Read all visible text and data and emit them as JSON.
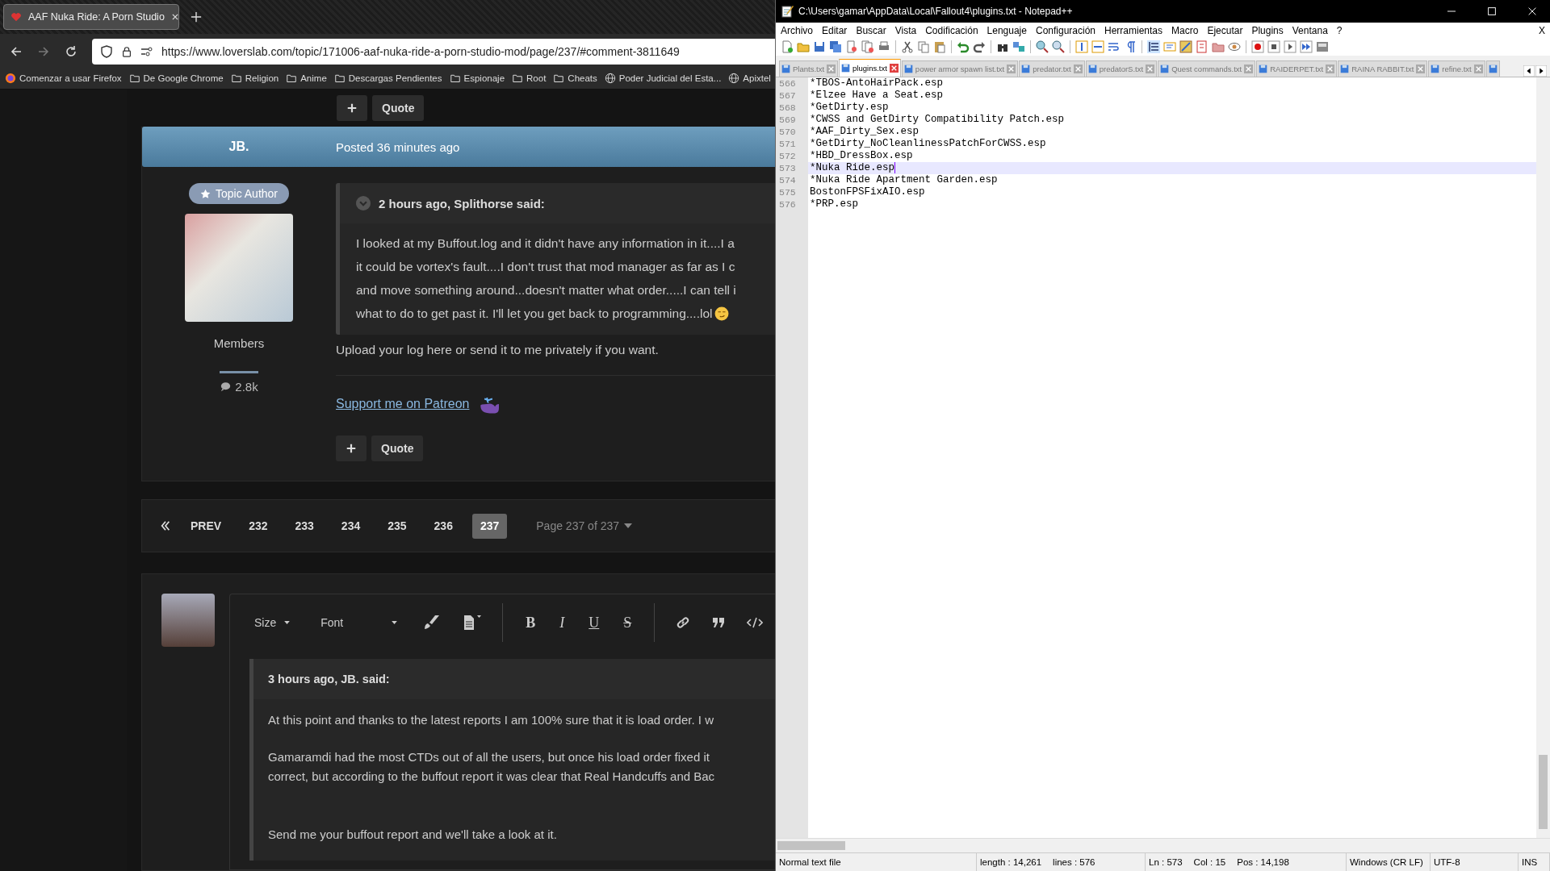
{
  "browser": {
    "tab": {
      "title": "AAF Nuka Ride: A Porn Studio"
    },
    "url": "https://www.loverslab.com/topic/171006-aaf-nuka-ride-a-porn-studio-mod/page/237/#comment-3811649",
    "bookmarks": [
      {
        "label": "Comenzar a usar Firefox",
        "kind": "firefox"
      },
      {
        "label": "De Google Chrome",
        "kind": "folder"
      },
      {
        "label": "Religion",
        "kind": "folder"
      },
      {
        "label": "Anime",
        "kind": "folder"
      },
      {
        "label": "Descargas Pendientes",
        "kind": "folder"
      },
      {
        "label": "Espionaje",
        "kind": "folder"
      },
      {
        "label": "Root",
        "kind": "folder"
      },
      {
        "label": "Cheats",
        "kind": "folder"
      },
      {
        "label": "Poder Judicial del Esta...",
        "kind": "globe"
      },
      {
        "label": "Apixtel",
        "kind": "globe"
      }
    ]
  },
  "forum": {
    "top_action": "Quote",
    "post": {
      "author": "JB.",
      "posted": "Posted 36 minutes ago",
      "badge": "Topic Author",
      "group": "Members",
      "post_count": "2.8k",
      "quote": {
        "header": "2 hours ago, Splithorse said:",
        "lines": [
          "I looked at my Buffout.log and it didn't have any information in it....I a",
          "it could be vortex's fault....I don't trust that mod manager as far as I c",
          "and move something around...doesn't matter what order.....I can tell i",
          "what to do to get past it.  I'll let you get back to programming....lol"
        ]
      },
      "text": "Upload your log here or send it to me privately if you want.",
      "link": "Support me on Patreon",
      "action": "Quote"
    },
    "pagination": {
      "prev": "PREV",
      "pages": [
        {
          "label": "232",
          "selected": false
        },
        {
          "label": "233",
          "selected": false
        },
        {
          "label": "234",
          "selected": false
        },
        {
          "label": "235",
          "selected": false
        },
        {
          "label": "236",
          "selected": false
        },
        {
          "label": "237",
          "selected": true
        }
      ],
      "jump": "Page 237 of 237"
    },
    "editor": {
      "size": "Size",
      "font": "Font",
      "format_buttons": [
        {
          "label": "B",
          "kind": "bold"
        },
        {
          "label": "I",
          "kind": "italic"
        },
        {
          "label": "U",
          "kind": "underline"
        },
        {
          "label": "S",
          "kind": "strike"
        }
      ],
      "quote": {
        "header": "3 hours ago, JB. said:",
        "paragraphs": [
          [
            "At this point and thanks to the latest reports I am 100% sure that it is load order. I w"
          ],
          [
            "Gamaramdi had the most CTDs out of all the users, but once his load order fixed it",
            "correct, but according to the buffout report it was clear that Real Handcuffs and Bac"
          ],
          [
            "Send me your buffout report and we'll take a look at it."
          ]
        ]
      }
    }
  },
  "notepad": {
    "title": "C:\\Users\\gamar\\AppData\\Local\\Fallout4\\plugins.txt - Notepad++",
    "menu": [
      "Archivo",
      "Editar",
      "Buscar",
      "Vista",
      "Codificación",
      "Lenguaje",
      "Configuración",
      "Herramientas",
      "Macro",
      "Ejecutar",
      "Plugins",
      "Ventana",
      "?"
    ],
    "menu_close": "X",
    "tabs": [
      {
        "label": "Plants.txt",
        "selected": false
      },
      {
        "label": "plugins.txt",
        "selected": true
      },
      {
        "label": "power armor spawn list.txt",
        "selected": false
      },
      {
        "label": "predator.txt",
        "selected": false
      },
      {
        "label": "predatorS.txt",
        "selected": false
      },
      {
        "label": "Quest commands.txt",
        "selected": false
      },
      {
        "label": "RAIDERPET.txt",
        "selected": false
      },
      {
        "label": "RAINA RABBIT.txt",
        "selected": false
      },
      {
        "label": "refine.txt",
        "selected": false
      }
    ],
    "lines": [
      {
        "number": "566",
        "text": "*TBOS-AntoHairPack.esp",
        "selected": false
      },
      {
        "number": "567",
        "text": "*Elzee Have a Seat.esp",
        "selected": false
      },
      {
        "number": "568",
        "text": "*GetDirty.esp",
        "selected": false
      },
      {
        "number": "569",
        "text": "*CWSS and GetDirty Compatibility Patch.esp",
        "selected": false
      },
      {
        "number": "570",
        "text": "*AAF_Dirty_Sex.esp",
        "selected": false
      },
      {
        "number": "571",
        "text": "*GetDirty_NoCleanlinessPatchForCWSS.esp",
        "selected": false
      },
      {
        "number": "572",
        "text": "*HBD_DressBox.esp",
        "selected": false
      },
      {
        "number": "573",
        "text": "*Nuka Ride.esp",
        "selected": true
      },
      {
        "number": "574",
        "text": "*Nuka Ride Apartment Garden.esp",
        "selected": false
      },
      {
        "number": "575",
        "text": "BostonFPSFixAIO.esp",
        "selected": false
      },
      {
        "number": "576",
        "text": "*PRP.esp",
        "selected": false
      }
    ],
    "status_bar": [
      [
        "Normal text file"
      ],
      [
        "length : 14,261",
        "lines : 576"
      ],
      [
        "Ln : 573",
        "Col : 15",
        "Pos : 14,198"
      ],
      [
        "Windows (CR LF)"
      ],
      [
        "UTF-8"
      ],
      [
        "INS"
      ]
    ]
  }
}
